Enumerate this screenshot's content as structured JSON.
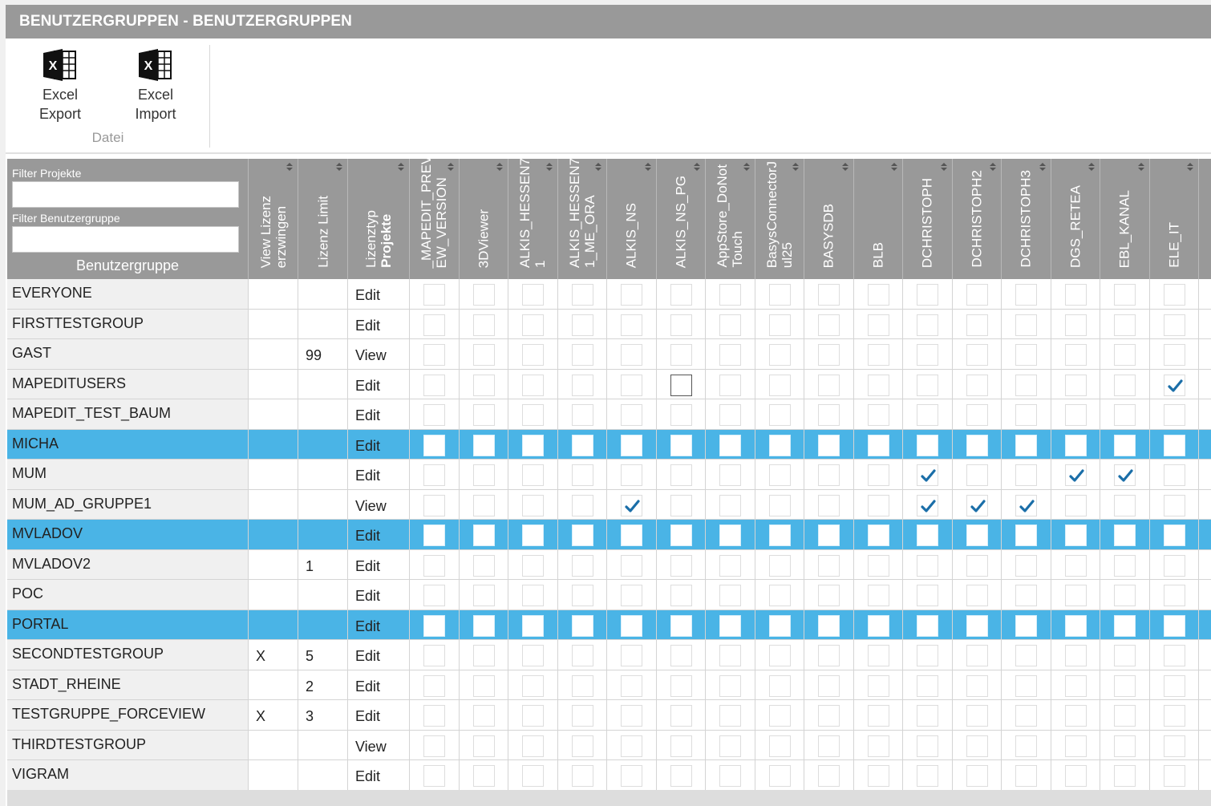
{
  "window": {
    "title": "BENUTZERGRUPPEN - BENUTZERGRUPPEN"
  },
  "ribbon": {
    "excel_export_label": "Excel Export",
    "excel_import_label": "Excel Import",
    "group_label": "Datei"
  },
  "filters": {
    "projekte_label": "Filter Projekte",
    "projekte_value": "",
    "gruppe_label": "Filter Benutzergruppe",
    "gruppe_value": ""
  },
  "columns": {
    "name": "Benutzergruppe",
    "view": [
      "View Lizenz",
      "erzwingen"
    ],
    "limit": "Lizenz Limit",
    "type": [
      "Lizenztyp",
      "Projekte"
    ],
    "projects": [
      [
        "_MAPEDIT_PREVI",
        "EW_VERSION"
      ],
      [
        "3DViewer"
      ],
      [
        "ALKIS_HESSEN7",
        "1"
      ],
      [
        "ALKIS_HESSEN7",
        "1_ME_ORA"
      ],
      [
        "ALKIS_NS"
      ],
      [
        "ALKIS_NS_PG"
      ],
      [
        "AppStore_DoNot",
        "Touch"
      ],
      [
        "BasysConnectorJ",
        "ul25"
      ],
      [
        "BASYSDB"
      ],
      [
        "BLB"
      ],
      [
        "DCHRISTOPH"
      ],
      [
        "DCHRISTOPH2"
      ],
      [
        "DCHRISTOPH3"
      ],
      [
        "DGS_RETEA"
      ],
      [
        "EBL_KANAL"
      ],
      [
        "ELE_IT"
      ]
    ]
  },
  "rows": [
    {
      "name": "EVERYONE",
      "view": "",
      "limit": "",
      "type": "Edit",
      "selected": false,
      "checks": []
    },
    {
      "name": "FIRSTTESTGROUP",
      "view": "",
      "limit": "",
      "type": "Edit",
      "selected": false,
      "checks": []
    },
    {
      "name": "GAST",
      "view": "",
      "limit": "99",
      "type": "View",
      "selected": false,
      "checks": []
    },
    {
      "name": "MAPEDITUSERS",
      "view": "",
      "limit": "",
      "type": "Edit",
      "selected": false,
      "checks": [
        15
      ],
      "focus": 5
    },
    {
      "name": "MAPEDIT_TEST_BAUM",
      "view": "",
      "limit": "",
      "type": "Edit",
      "selected": false,
      "checks": []
    },
    {
      "name": "MICHA",
      "view": "",
      "limit": "",
      "type": "Edit",
      "selected": true,
      "checks": []
    },
    {
      "name": "MUM",
      "view": "",
      "limit": "",
      "type": "Edit",
      "selected": false,
      "checks": [
        10,
        13,
        14
      ]
    },
    {
      "name": "MUM_AD_GRUPPE1",
      "view": "",
      "limit": "",
      "type": "View",
      "selected": false,
      "checks": [
        4,
        10,
        11,
        12
      ]
    },
    {
      "name": "MVLADOV",
      "view": "",
      "limit": "",
      "type": "Edit",
      "selected": true,
      "checks": []
    },
    {
      "name": "MVLADOV2",
      "view": "",
      "limit": "1",
      "type": "Edit",
      "selected": false,
      "checks": []
    },
    {
      "name": "POC",
      "view": "",
      "limit": "",
      "type": "Edit",
      "selected": false,
      "checks": []
    },
    {
      "name": "PORTAL",
      "view": "",
      "limit": "",
      "type": "Edit",
      "selected": true,
      "checks": []
    },
    {
      "name": "SECONDTESTGROUP",
      "view": "X",
      "limit": "5",
      "type": "Edit",
      "selected": false,
      "checks": []
    },
    {
      "name": "STADT_RHEINE",
      "view": "",
      "limit": "2",
      "type": "Edit",
      "selected": false,
      "checks": []
    },
    {
      "name": "TESTGRUPPE_FORCEVIEW",
      "view": "X",
      "limit": "3",
      "type": "Edit",
      "selected": false,
      "checks": []
    },
    {
      "name": "THIRDTESTGROUP",
      "view": "",
      "limit": "",
      "type": "View",
      "selected": false,
      "checks": []
    },
    {
      "name": "VIGRAM",
      "view": "",
      "limit": "",
      "type": "Edit",
      "selected": false,
      "checks": []
    }
  ],
  "colors": {
    "header": "#999999",
    "selected_row": "#4ab4e6",
    "check": "#1a6ea8"
  },
  "icons": {
    "excel_export": "excel-icon",
    "excel_import": "excel-icon",
    "sort": "sort-arrows-icon",
    "check": "checkmark-icon"
  }
}
